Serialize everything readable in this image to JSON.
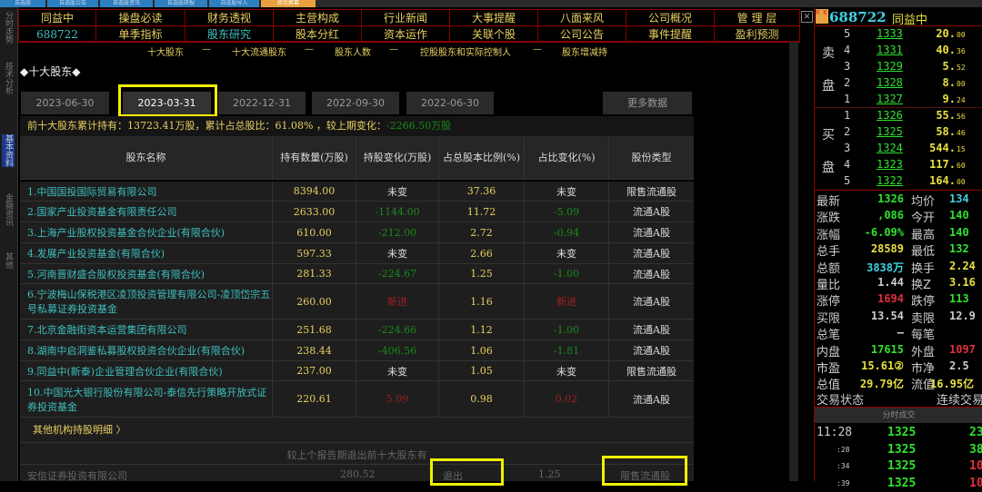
{
  "top_tabs": [
    "自选股",
    "自选股公告",
    "自选股资讯",
    "自选股研报",
    "自选股导入",
    "综合屏幕"
  ],
  "left_bar": [
    "分时走势",
    "技术分析",
    "基本资料",
    "金融资讯",
    "其他"
  ],
  "stock": {
    "name": "同益中",
    "code": "688722"
  },
  "nav": {
    "row1": [
      "操盘必读",
      "财务透视",
      "主营构成",
      "行业新闻",
      "大事提醒",
      "八面来风",
      "公司概况",
      "管 理 层"
    ],
    "row2": [
      "单季指标",
      "股东研究",
      "股本分红",
      "资本运作",
      "关联个股",
      "公司公告",
      "事件提醒",
      "盈利预测"
    ],
    "active": "股东研究"
  },
  "subnav": [
    "十大股东",
    "—",
    "十大流通股东",
    "—",
    "股东人数",
    "—",
    "控股股东和实际控制人",
    "—",
    "股东增减持"
  ],
  "section_title": "◆十大股东◆",
  "date_tabs": [
    "2023-06-30",
    "2023-03-31",
    "2022-12-31",
    "2022-09-30",
    "2022-06-30"
  ],
  "selected_tab": "2023-03-31",
  "more_data": "更多数据",
  "summary": {
    "text": "前十大股东累计持有：13723.41万股，累计占总股比：61.08% ，较上期变化：",
    "change": "-2266.50万股"
  },
  "table": {
    "headers": [
      "股东名称",
      "持有数量(万股)",
      "持股变化(万股)",
      "占总股本比例(%)",
      "占比变化(%)",
      "股份类型"
    ],
    "rows": [
      [
        "1.中国国投国际贸易有限公司",
        "8394.00",
        "未变",
        "37.36",
        "未变",
        "限售流通股"
      ],
      [
        "2.国家产业投资基金有限责任公司",
        "2633.00",
        "-1144.00",
        "11.72",
        "-5.09",
        "流通A股"
      ],
      [
        "3.上海产业股权投资基金合伙企业(有限合伙)",
        "610.00",
        "-212.00",
        "2.72",
        "-0.94",
        "流通A股"
      ],
      [
        "4.发展产业投资基金(有限合伙)",
        "597.33",
        "未变",
        "2.66",
        "未变",
        "流通A股"
      ],
      [
        "5.河南晋财盛合股权投资基金(有限合伙)",
        "281.33",
        "-224.67",
        "1.25",
        "-1.00",
        "流通A股"
      ],
      [
        "6.宁波梅山保税港区凌顶投资管理有限公司-凌顶岱宗五号私募证券投资基金",
        "260.00",
        "新进",
        "1.16",
        "新进",
        "流通A股"
      ],
      [
        "7.北京金融街资本运营集团有限公司",
        "251.68",
        "-224.66",
        "1.12",
        "-1.00",
        "流通A股"
      ],
      [
        "8.湖南中启洞鉴私募股权投资合伙企业(有限合伙)",
        "238.44",
        "-406.56",
        "1.06",
        "-1.81",
        "流通A股"
      ],
      [
        "9.同益中(新泰)企业管理合伙企业(有限合伙)",
        "237.00",
        "未变",
        "1.05",
        "未变",
        "限售流通股"
      ],
      [
        "10.中国光大银行股份有限公司-泰信先行策略开放式证券投资基金",
        "220.61",
        "5.09",
        "0.98",
        "0.02",
        "流通A股"
      ]
    ]
  },
  "other_link": "其他机构持股明细 〉",
  "exit_caption": "较上个报告期退出前十大股东有",
  "exit_row": [
    "安信证券投资有限公司",
    "280.52",
    "退出",
    "1.25",
    "限售流通股"
  ],
  "quote": {
    "sell_label": [
      "卖",
      "盘"
    ],
    "buy_label": [
      "买",
      "盘"
    ],
    "sell": [
      [
        "5",
        "1333",
        "20.",
        "00"
      ],
      [
        "4",
        "1331",
        "40.",
        "36"
      ],
      [
        "3",
        "1329",
        "5.",
        "52"
      ],
      [
        "2",
        "1328",
        "8.",
        "00"
      ],
      [
        "1",
        "1327",
        "9.",
        "24"
      ]
    ],
    "buy": [
      [
        "1",
        "1326",
        "55.",
        "56"
      ],
      [
        "2",
        "1325",
        "58.",
        "46"
      ],
      [
        "3",
        "1324",
        "544.",
        "15"
      ],
      [
        "4",
        "1323",
        "117.",
        "60"
      ],
      [
        "5",
        "1322",
        "164.",
        "00"
      ]
    ],
    "stats": [
      [
        "最新",
        "1326",
        "均价",
        "134"
      ],
      [
        "涨跌",
        ",086",
        "今开",
        "140"
      ],
      [
        "涨幅",
        "-6.09%",
        "最高",
        "140"
      ],
      [
        "总手",
        "28589",
        "最低",
        "132"
      ],
      [
        "总额",
        "3838万",
        "换手",
        "2.24"
      ],
      [
        "量比",
        "1.44",
        "换Z",
        "3.16"
      ],
      [
        "涨停",
        "1694",
        "跌停",
        "113"
      ],
      [
        "买限",
        "13.54",
        "卖限",
        "12.9"
      ],
      [
        "总笔",
        "–",
        "每笔",
        ""
      ],
      [
        "内盘",
        "17615",
        "外盘",
        "1097"
      ],
      [
        "市盈",
        "15.61②",
        "市净",
        "2.5"
      ],
      [
        "总值",
        "29.79亿",
        "流值",
        "16.95亿"
      ]
    ],
    "status": [
      "交易状态",
      "连续交易"
    ],
    "ticks_title": "分时成交",
    "ticks": [
      [
        "11:28",
        "1325",
        "23"
      ],
      [
        ":28",
        "1325",
        "38"
      ],
      [
        ":34",
        "1325",
        "10"
      ],
      [
        ":39",
        "1325",
        "10"
      ]
    ]
  },
  "colors": {
    "accent": "#e8d060",
    "up": "#e03040",
    "down": "#30e030",
    "highlight": "#f0f000"
  }
}
